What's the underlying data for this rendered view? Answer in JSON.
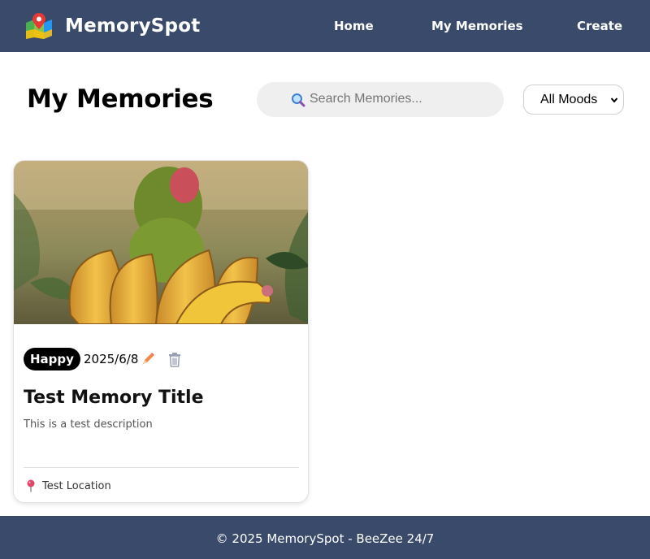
{
  "header": {
    "brand_icon": "map-pin-icon",
    "brand_name": "MemorySpot",
    "nav": [
      {
        "label": "Home"
      },
      {
        "label": "My Memories"
      },
      {
        "label": "Create"
      }
    ],
    "background": "#3a4a6b"
  },
  "main": {
    "title": "My Memories",
    "search": {
      "icon": "search-icon",
      "placeholder": "Search Memories...",
      "value": ""
    },
    "mood_filter": {
      "selected": "All Moods"
    }
  },
  "memories": [
    {
      "mood": "Happy",
      "date": "2025/6/8",
      "title": "Test Memory Title",
      "description": "This is a test description",
      "location": "Test Location",
      "edit_icon": "pencil-icon",
      "delete_icon": "trash-icon",
      "location_icon": "pin-icon"
    }
  ],
  "footer": {
    "text": "© 2025 MemorySpot - BeeZee 24/7"
  }
}
